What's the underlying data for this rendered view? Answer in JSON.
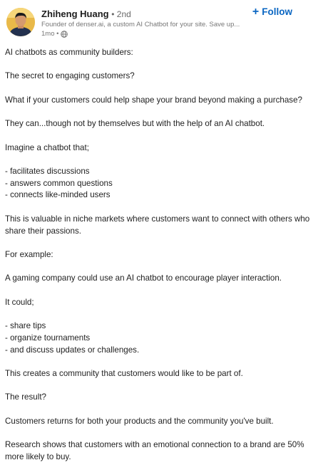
{
  "author": {
    "name": "Zhiheng Huang",
    "degree": "• 2nd",
    "headline": "Founder of denser.ai, a custom AI Chatbot for your site. Save up...",
    "time": "1mo •",
    "avatar_icon": "person-avatar-icon",
    "visibility_icon": "globe-icon"
  },
  "follow": {
    "label": "Follow",
    "icon": "plus-icon",
    "color": "#0a66c2"
  },
  "post": {
    "lines": [
      "AI chatbots as community builders:",
      "",
      "The secret to engaging customers?",
      "",
      "What if your customers could help shape your brand beyond making a purchase?",
      "",
      "They can...though not by themselves but with the help of an AI chatbot.",
      "",
      "Imagine a chatbot that;",
      "",
      "- facilitates discussions",
      "- answers common questions",
      "- connects like-minded users",
      "",
      "This is valuable in niche markets where customers want to connect with others who",
      "share their passions.",
      "",
      "For example:",
      "",
      "A gaming company could use an AI chatbot to encourage player interaction.",
      "",
      " It could;",
      "",
      "- share tips",
      "- organize tournaments",
      "- and discuss updates or challenges.",
      "",
      "This creates a community that customers would like to be part of.",
      "",
      "The result?",
      "",
      "Customers returns for both your products and the community you've built.",
      "",
      "Research shows that customers with an emotional connection to a brand are 50%",
      "more likely to buy."
    ]
  }
}
